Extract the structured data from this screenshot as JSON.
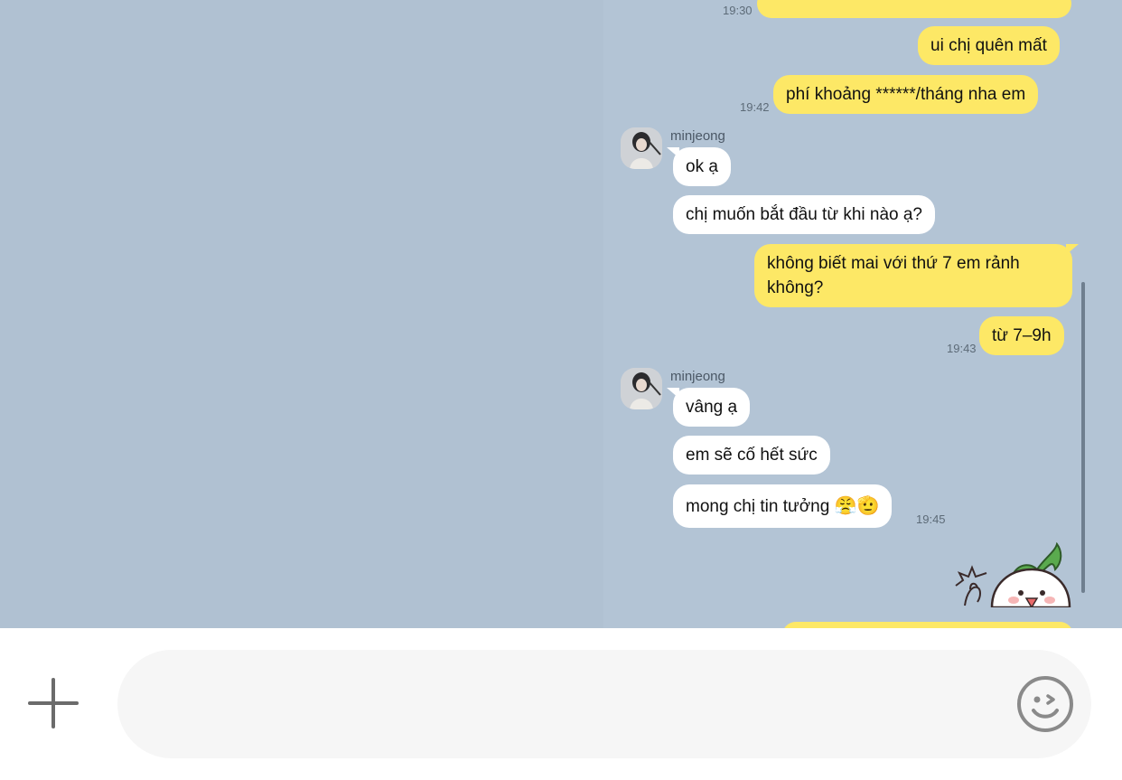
{
  "messages": {
    "cut_time": "19:30",
    "m1": "ui chị quên mất",
    "m2": "phí khoảng ******/tháng nha em",
    "t2": "19:42",
    "sender1": "minjeong",
    "m3": "ok ạ",
    "m4": "chị muốn bắt đầu từ khi nào ạ?",
    "m5_line1": "không biết mai với thứ 7 em rảnh",
    "m5_line2": "không?",
    "m6": "từ 7–9h",
    "t6": "19:43",
    "sender2": "minjeong",
    "m7": "vâng ạ",
    "m8": "em sẽ cố hết sức",
    "m9": "mong chị tin tưởng",
    "m9_emoji": "😤🫡",
    "t9": "19:45"
  },
  "input": {
    "placeholder": "",
    "value": ""
  },
  "icons": {
    "plus": "plus-icon",
    "emoji": "emoji-face-icon",
    "sticker": "radish-sticker"
  },
  "colors": {
    "chat_background": "#b0c1d2",
    "my_bubble": "#fde866",
    "their_bubble": "#ffffff"
  }
}
